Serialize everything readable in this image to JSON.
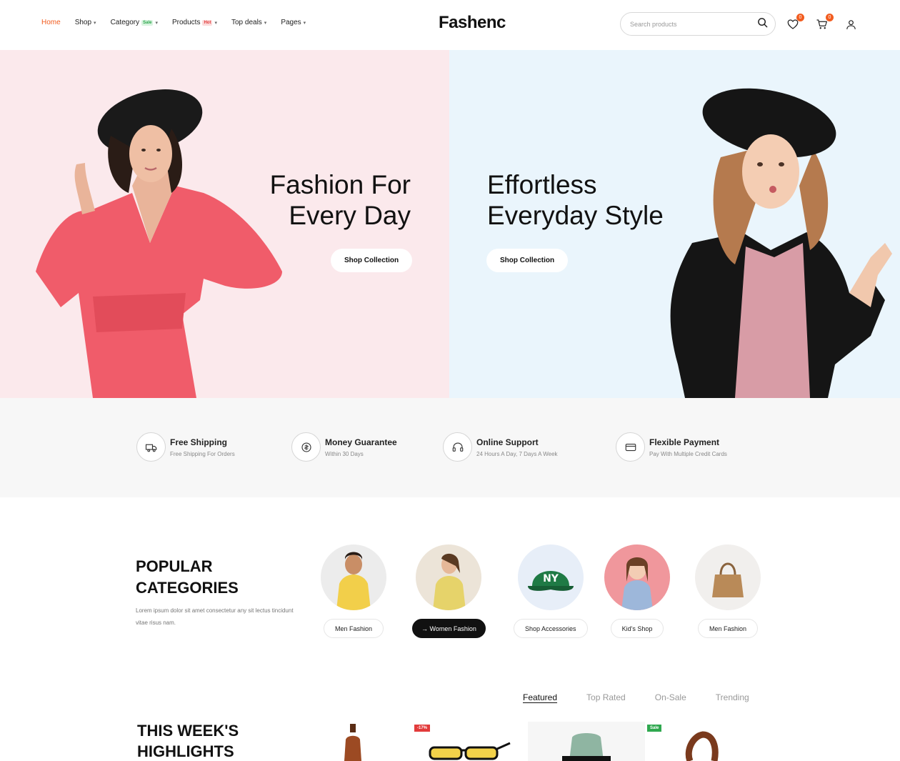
{
  "brand": {
    "logo": "Fashenc",
    "accent": "#f25c1f"
  },
  "nav": {
    "items": [
      {
        "label": "Home",
        "active": true,
        "dropdown": false
      },
      {
        "label": "Shop",
        "dropdown": true
      },
      {
        "label": "Category",
        "badge": "Sale",
        "badge_color": "#2fa84f",
        "dropdown": true
      },
      {
        "label": "Products",
        "badge": "Hot",
        "badge_color": "#e23b3b",
        "dropdown": true
      },
      {
        "label": "Top deals",
        "dropdown": true
      },
      {
        "label": "Pages",
        "dropdown": true
      }
    ]
  },
  "header": {
    "search_placeholder": "Search products",
    "wishlist_count": "0",
    "cart_count": "0"
  },
  "hero": {
    "left": {
      "title": "Fashion For\nEvery Day",
      "button": "Shop Collection",
      "bg": "#fbe9ec"
    },
    "right": {
      "title": "Effortless\nEveryday Style",
      "button": "Shop Collection",
      "bg": "#eaf5fc"
    }
  },
  "features": [
    {
      "icon": "truck-icon",
      "title": "Free Shipping",
      "subtitle": "Free Shipping For Orders"
    },
    {
      "icon": "money-icon",
      "title": "Money Guarantee",
      "subtitle": "Within 30 Days"
    },
    {
      "icon": "headset-icon",
      "title": "Online Support",
      "subtitle": "24 Hours A Day, 7 Days A Week"
    },
    {
      "icon": "credit-card-icon",
      "title": "Flexible Payment",
      "subtitle": "Pay With Multiple Credit Cards"
    }
  ],
  "categories": {
    "heading": "POPULAR\nCATEGORIES",
    "description": "Lorem ipsum dolor sit amet consectetur any sit lectus tincidunt vitae risus nam.",
    "items": [
      {
        "label": "Men Fashion",
        "active": false
      },
      {
        "label": "Women Fashion",
        "active": true,
        "arrow": "→"
      },
      {
        "label": "Shop Accessories",
        "active": false
      },
      {
        "label": "Kid's Shop",
        "active": false
      },
      {
        "label": "Men Fashion",
        "active": false
      }
    ]
  },
  "highlights": {
    "heading": "THIS WEEK'S\nHIGHLIGHTS",
    "tabs": [
      {
        "label": "Featured",
        "active": true
      },
      {
        "label": "Top Rated",
        "active": false
      },
      {
        "label": "On-Sale",
        "active": false
      },
      {
        "label": "Trending",
        "active": false
      }
    ],
    "badges": {
      "discount": "-17%",
      "sale": "Sale"
    }
  }
}
